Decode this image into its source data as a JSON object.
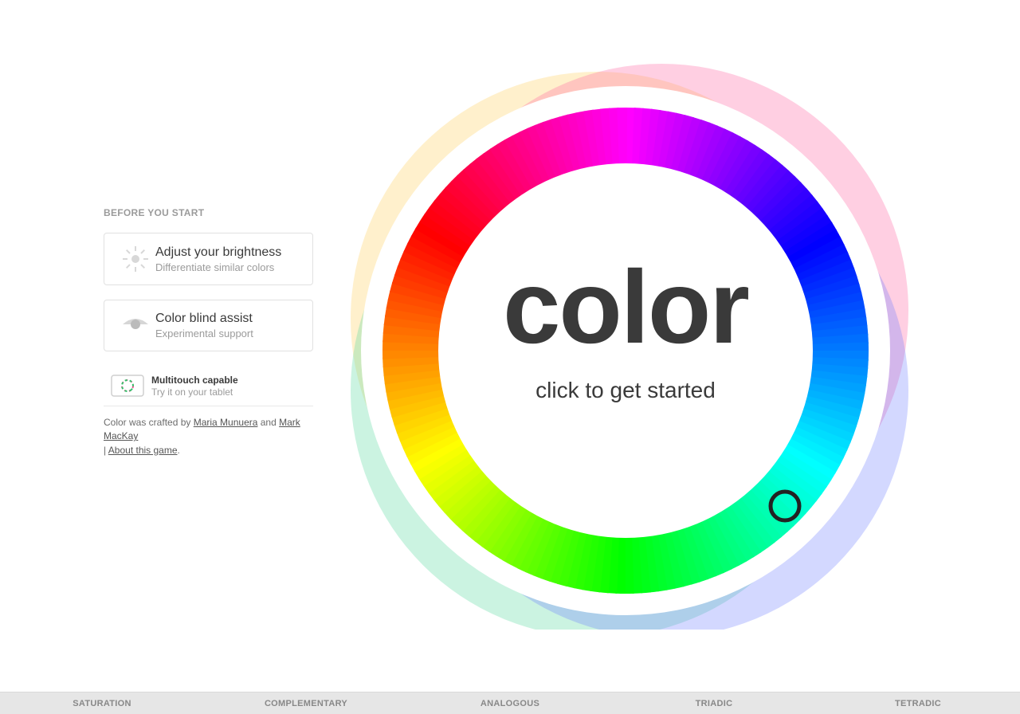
{
  "sidebar": {
    "heading": "BEFORE YOU START",
    "brightness": {
      "title": "Adjust your brightness",
      "subtitle": "Differentiate similar colors"
    },
    "colorblind": {
      "title": "Color blind assist",
      "subtitle": "Experimental support"
    },
    "multitouch": {
      "title": "Multitouch capable",
      "subtitle": "Try it on your tablet"
    }
  },
  "credits": {
    "prefix": "Color was crafted by ",
    "author1": "Maria Munuera",
    "middle": " and ",
    "author2": "Mark MacKay",
    "about_sep": " | ",
    "about": "About this game",
    "suffix": "."
  },
  "wheel": {
    "title": "color",
    "subtitle": "click to get started"
  },
  "footer": [
    "SATURATION",
    "COMPLEMENTARY",
    "ANALOGOUS",
    "TRIADIC",
    "TETRADIC"
  ]
}
